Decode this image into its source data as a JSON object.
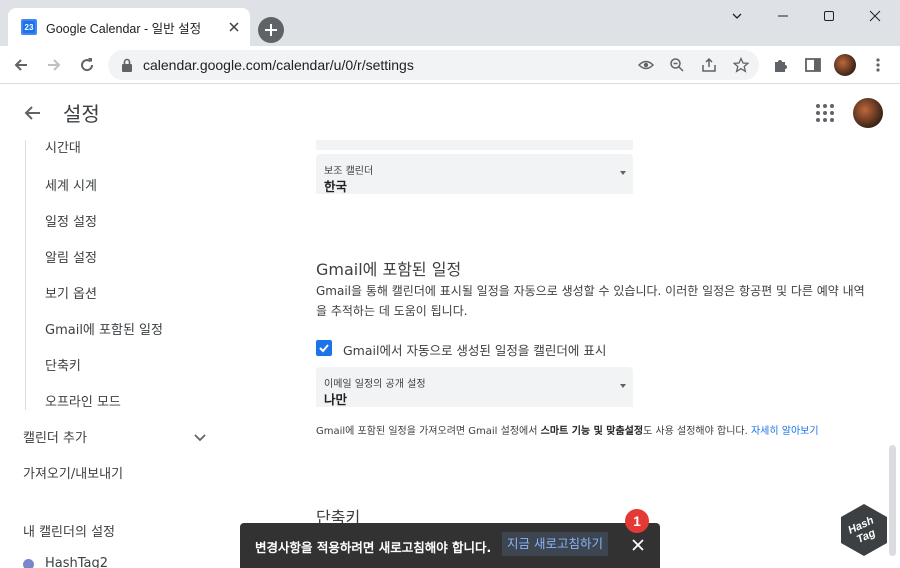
{
  "browser": {
    "tab_title": "Google Calendar - 일반 설정",
    "favicon_text": "23",
    "url": "calendar.google.com/calendar/u/0/r/settings"
  },
  "header": {
    "title": "설정"
  },
  "sidebar": {
    "partial_item": "시간대",
    "sub_items": [
      "세계 시계",
      "일정 설정",
      "알림 설정",
      "보기 옵션",
      "Gmail에 포함된 일정",
      "단축키",
      "오프라인 모드"
    ],
    "add_calendar": "캘린더 추가",
    "import_export": "가져오기/내보내기",
    "my_calendars_heading": "내 캘린더의 설정",
    "calendar_name": "HashTag2",
    "calendar_color": "#7986cb"
  },
  "main": {
    "secondary_calendar": {
      "label": "보조 캘린더",
      "value": "한국"
    },
    "gmail_section": {
      "title": "Gmail에 포함된 일정",
      "description": "Gmail을 통해 캘린더에 표시될 일정을 자동으로 생성할 수 있습니다. 이러한 일정은 항공편 및 다른 예약 내역을 추적하는 데 도움이 됩니다.",
      "checkbox_label": "Gmail에서 자동으로 생성된 일정을 캘린더에 표시",
      "checkbox_checked": true,
      "privacy_select_label": "이메일 일정의 공개 설정",
      "privacy_select_value": "나만",
      "note_before": "Gmail에 포함된 일정을 가져오려면 Gmail 설정에서 ",
      "note_bold": "스마트 기능 및 맞춤설정",
      "note_after": "도 사용 설정해야 합니다. ",
      "note_link": "자세히 알아보기"
    },
    "shortcuts_title": "단축키"
  },
  "snackbar": {
    "message": "변경사항을 적용하려면 새로고침해야 합니다.",
    "action": "지금 새로고침하기"
  },
  "annotation": {
    "step_number": "1"
  },
  "watermark": {
    "text_line1": "Hash",
    "text_line2": "Tag"
  },
  "colors": {
    "accent": "#1a73e8",
    "snackbar_bg": "#323232",
    "snackbar_action": "#8ab4f8",
    "badge": "#e53935"
  }
}
